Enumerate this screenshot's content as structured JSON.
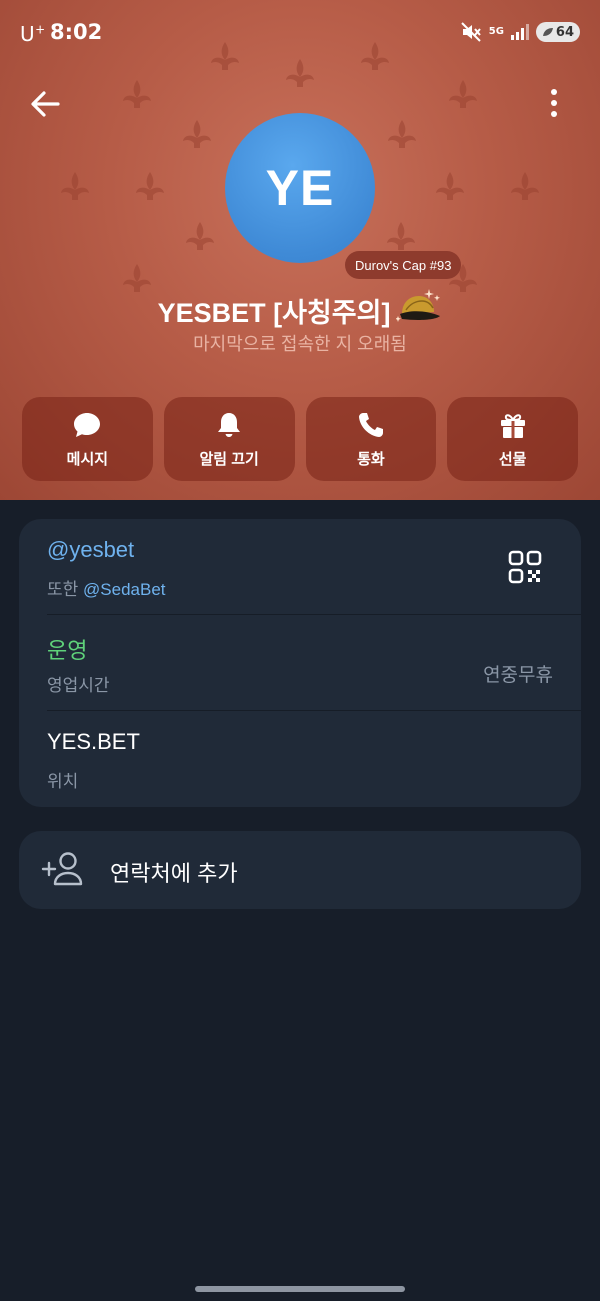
{
  "status_bar": {
    "carrier": "U",
    "carrier_sup": "+",
    "time": "8:02",
    "network": "5G",
    "battery": "64"
  },
  "profile": {
    "avatar_initials": "YE",
    "gift_tag": "Durov's Cap #93",
    "name": "YESBET [사칭주의]",
    "last_seen": "마지막으로 접속한 지 오래됨",
    "header_color": "#b65c47",
    "avatar_color": "#4590dd"
  },
  "actions": [
    {
      "label": "메시지",
      "icon": "message-icon"
    },
    {
      "label": "알림 끄기",
      "icon": "bell-icon"
    },
    {
      "label": "통화",
      "icon": "phone-icon"
    },
    {
      "label": "선물",
      "icon": "gift-icon"
    }
  ],
  "info": {
    "username": "@yesbet",
    "also_prefix": "또한",
    "also_username": "@SedaBet",
    "hours_title": "운영",
    "hours_label": "영업시간",
    "hours_value": "연중무휴",
    "location_title": "YES.BET",
    "location_label": "위치",
    "username_color": "#6fb2ee",
    "hours_title_color": "#5fd27a"
  },
  "add_contact": {
    "label": "연락처에 추가",
    "icon": "add-person-icon"
  }
}
